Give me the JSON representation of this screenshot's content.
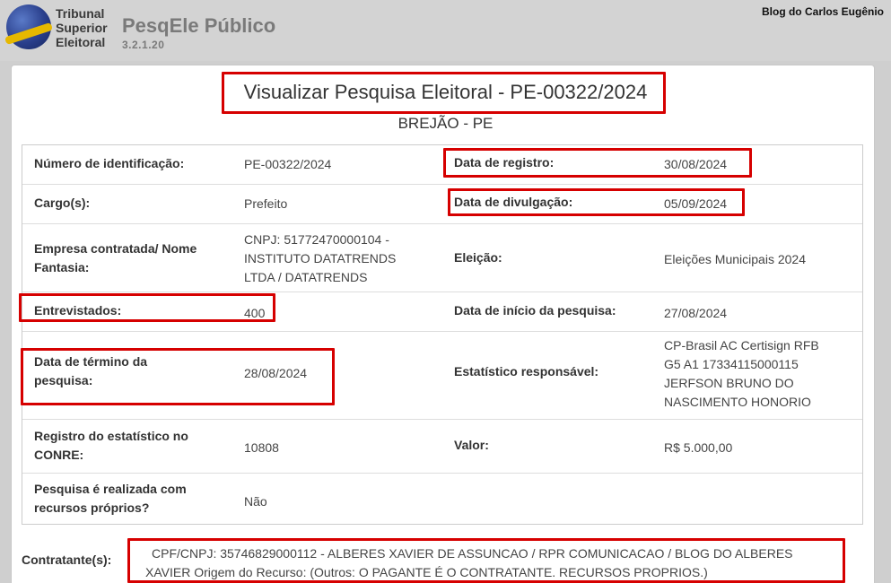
{
  "header": {
    "logo_lines": [
      "Tribunal",
      "Superior",
      "Eleitoral"
    ],
    "app_title": "PesqEle Público",
    "version": "3.2.1.20",
    "watermark": "Blog do Carlos Eugênio"
  },
  "page": {
    "title": "Visualizar Pesquisa Eleitoral - PE-00322/2024",
    "subtitle": "BREJÃO - PE"
  },
  "fields": {
    "numero_label": "Número de identificação:",
    "numero_value": "PE-00322/2024",
    "data_registro_label": "Data de registro:",
    "data_registro_value": "30/08/2024",
    "cargo_label": "Cargo(s):",
    "cargo_value": "Prefeito",
    "data_divulgacao_label": "Data de divulgação:",
    "data_divulgacao_value": "05/09/2024",
    "empresa_label_1": "Empresa contratada/ Nome",
    "empresa_label_2": "Fantasia:",
    "empresa_value_1": "CNPJ: 51772470000104 -",
    "empresa_value_2": "INSTITUTO DATATRENDS",
    "empresa_value_3": "LTDA / DATATRENDS",
    "eleicao_label": "Eleição:",
    "eleicao_value": "Eleições Municipais 2024",
    "entrevistados_label": "Entrevistados:",
    "entrevistados_value": "400",
    "data_inicio_label": "Data de início da pesquisa:",
    "data_inicio_value": "27/08/2024",
    "data_termino_label_1": "Data de término da",
    "data_termino_label_2": "pesquisa:",
    "data_termino_value": "28/08/2024",
    "estatistico_label": "Estatístico responsável:",
    "estatistico_value_1": "CP-Brasil AC Certisign RFB",
    "estatistico_value_2": "G5 A1 17334115000115",
    "estatistico_value_3": "JERFSON BRUNO DO",
    "estatistico_value_4": "NASCIMENTO HONORIO",
    "conre_label_1": "Registro do estatístico no",
    "conre_label_2": "CONRE:",
    "conre_value": "10808",
    "valor_label": "Valor:",
    "valor_value": "R$ 5.000,00",
    "recursos_label_1": "Pesquisa é realizada com",
    "recursos_label_2": "recursos próprios?",
    "recursos_value": "Não"
  },
  "contratante": {
    "label": "Contratante(s):",
    "value_line_1": "CPF/CNPJ: 35746829000112 - ALBERES XAVIER DE ASSUNCAO / RPR COMUNICACAO / BLOG DO ALBERES",
    "value_line_2": "XAVIER Origem do Recurso: (Outros: O PAGANTE É O CONTRATANTE. RECURSOS PROPRIOS.)"
  },
  "colors": {
    "highlight": "#d60000",
    "header_bg": "#d3d3d3"
  }
}
